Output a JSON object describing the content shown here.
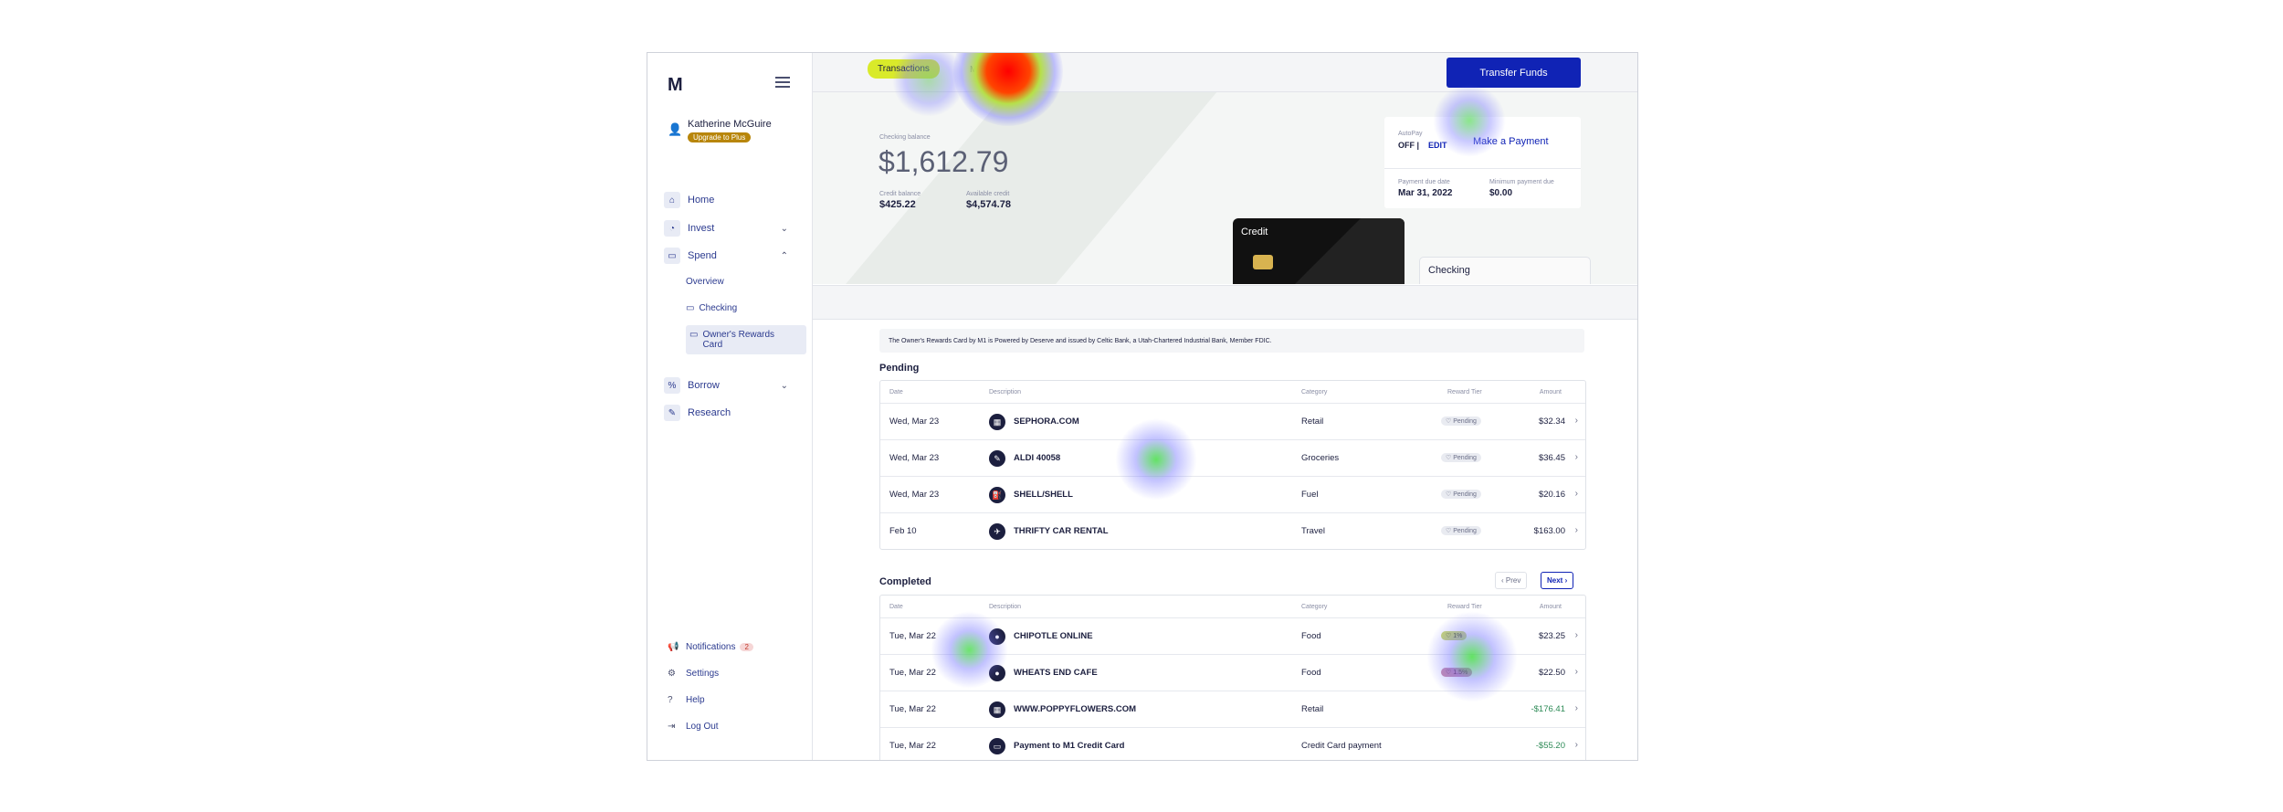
{
  "sidebar": {
    "logo": "M",
    "user": {
      "name": "Katherine McGuire",
      "badge": "Upgrade to Plus"
    },
    "items": [
      {
        "label": "Home",
        "icon": "home-icon",
        "glyph": "⌂"
      },
      {
        "label": "Invest",
        "icon": "pie-chart-icon",
        "glyph": "◔"
      },
      {
        "label": "Spend",
        "icon": "card-icon",
        "glyph": "▭"
      },
      {
        "label": "Borrow",
        "icon": "percent-icon",
        "glyph": "%"
      },
      {
        "label": "Research",
        "icon": "research-icon",
        "glyph": "✎"
      }
    ],
    "spend_sub": [
      "Overview",
      "Checking",
      "Owner's Rewards Card"
    ],
    "footer": [
      {
        "label": "Notifications",
        "icon": "megaphone-icon",
        "glyph": "📢",
        "count": "2"
      },
      {
        "label": "Settings",
        "icon": "gear-icon",
        "glyph": "⚙"
      },
      {
        "label": "Help",
        "icon": "help-icon",
        "glyph": "?"
      },
      {
        "label": "Log Out",
        "icon": "logout-icon",
        "glyph": "⇥"
      }
    ]
  },
  "topbar": {
    "tab_active": "Transactions",
    "tab_manage": "Manage card",
    "transfer_button": "Transfer Funds"
  },
  "hero": {
    "checking_balance_label": "Checking balance",
    "checking_balance": "$1,612.79",
    "credit_balance_label": "Credit balance",
    "credit_balance": "$425.22",
    "available_credit_label": "Available credit",
    "available_credit": "$4,574.78",
    "autopay_label": "AutoPay",
    "autopay_status": "OFF |",
    "autopay_edit": "EDIT",
    "make_payment": "Make a Payment",
    "payment_due_date_label": "Payment due date",
    "payment_due_date": "Mar 31, 2022",
    "minimum_payment_label": "Minimum payment due",
    "minimum_payment": "$0.00",
    "credit_card_label": "Credit",
    "checking_card_label": "Checking"
  },
  "disclaimer": "The Owner's Rewards Card by M1 is Powered by Deserve and issued by Celtic Bank, a Utah-Chartered Industrial Bank, Member FDIC.",
  "columns": {
    "date": "Date",
    "description": "Description",
    "category": "Category",
    "reward_tier": "Reward Tier",
    "amount": "Amount"
  },
  "pending": {
    "title": "Pending",
    "rows": [
      {
        "date": "Wed, Mar 23",
        "description": "SEPHORA.COM",
        "category": "Retail",
        "tier": "Pending",
        "amount": "$32.34"
      },
      {
        "date": "Wed, Mar 23",
        "description": "ALDI 40058",
        "category": "Groceries",
        "tier": "Pending",
        "amount": "$36.45"
      },
      {
        "date": "Wed, Mar 23",
        "description": "SHELL/SHELL",
        "category": "Fuel",
        "tier": "Pending",
        "amount": "$20.16"
      },
      {
        "date": "Feb 10",
        "description": "THRIFTY CAR RENTAL",
        "category": "Travel",
        "tier": "Pending",
        "amount": "$163.00"
      }
    ]
  },
  "completed": {
    "title": "Completed",
    "prev": "‹ Prev",
    "next": "Next ›",
    "rows": [
      {
        "date": "Tue, Mar 22",
        "description": "CHIPOTLE ONLINE",
        "category": "Food",
        "tier": "1%",
        "amount": "$23.25"
      },
      {
        "date": "Tue, Mar 22",
        "description": "WHEATS END CAFE",
        "category": "Food",
        "tier": "1.5%",
        "amount": "$22.50"
      },
      {
        "date": "Tue, Mar 22",
        "description": "WWW.POPPYFLOWERS.COM",
        "category": "Retail",
        "tier": "",
        "amount": "-$176.41"
      },
      {
        "date": "Tue, Mar 22",
        "description": "Payment to M1 Credit Card",
        "category": "Credit Card payment",
        "tier": "",
        "amount": "-$55.20"
      }
    ]
  },
  "colors": {
    "accent": "#1023b5",
    "tab_highlight": "#d9ea2a",
    "badge": "#b8860b",
    "negative_amount": "#2e8b57"
  }
}
